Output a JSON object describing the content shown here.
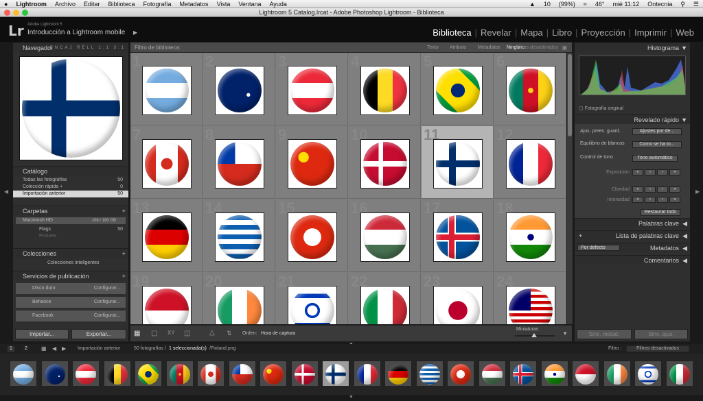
{
  "menubar": {
    "apple": "",
    "app": "Lightroom",
    "items": [
      "Archivo",
      "Editar",
      "Biblioteca",
      "Fotografía",
      "Metadatos",
      "Vista",
      "Ventana",
      "Ayuda"
    ],
    "battery": "(99%)",
    "badge": "10",
    "temp": "46°",
    "clock": "mié 11:12",
    "user": "Ontecnia"
  },
  "window_title": "Lightroom 5 Catalog.lrcat - Adobe Photoshop Lightroom - Biblioteca",
  "identity": {
    "product": "Adobe Lightroom 5",
    "subtitle": "Introducción a Lightroom mobile"
  },
  "modules": [
    "Biblioteca",
    "Revelar",
    "Mapa",
    "Libro",
    "Proyección",
    "Imprimir",
    "Web"
  ],
  "left": {
    "navigator": {
      "title": "Navegador",
      "modes": [
        "ENCAJ",
        "RELL",
        "1:1",
        "3:1"
      ]
    },
    "catalog": {
      "title": "Catálogo",
      "rows": [
        {
          "label": "Todas las fotografías",
          "count": "50"
        },
        {
          "label": "Colección rápida +",
          "count": "0"
        },
        {
          "label": "Importación anterior",
          "count": "50"
        }
      ]
    },
    "folders": {
      "title": "Carpetas",
      "drive": "Macintosh HD",
      "drive_size": "106 / 180 GB",
      "items": [
        {
          "label": "Flags",
          "count": "50"
        },
        {
          "label": "Pictures",
          "count": ""
        }
      ]
    },
    "collections": {
      "title": "Colecciones",
      "item": "Colecciones inteligentes"
    },
    "publish": {
      "title": "Servicios de publicación",
      "services": [
        {
          "label": "Disco duro",
          "action": "Configurar..."
        },
        {
          "label": "Behance",
          "action": "Configurar..."
        },
        {
          "label": "Facebook",
          "action": "Configurar..."
        }
      ]
    },
    "import_btn": "Importar...",
    "export_btn": "Exportar..."
  },
  "filterbar": {
    "label": "Filtro de biblioteca:",
    "tabs": [
      "Texto",
      "Atributo",
      "Metadatos",
      "Ninguno"
    ],
    "status": "Filtros desactivados"
  },
  "grid_numbers": [
    "1",
    "2",
    "3",
    "4",
    "5",
    "6",
    "7",
    "8",
    "9",
    "10",
    "11",
    "12",
    "13",
    "14",
    "15",
    "16",
    "17",
    "18",
    "19",
    "20",
    "21",
    "22",
    "23",
    "24"
  ],
  "toolbar": {
    "order_label": "Orden:",
    "order_value": "Hora de captura",
    "thumbs_label": "Miniaturas"
  },
  "right": {
    "histogram": {
      "title": "Histograma",
      "caption": "Fotografía original"
    },
    "quick_develop": {
      "title": "Revelado rápido",
      "preset_label": "Ajus. prees. guard.",
      "preset_value": "Ajustes por de...",
      "wb_label": "Equilibrio de blancos",
      "wb_value": "Como se ha to...",
      "tone_label": "Control de tono",
      "tone_value": "Tono automático",
      "exposure": "Exposición",
      "clarity": "Claridad",
      "vibrance": "Intensidad",
      "reset": "Restaurar todo"
    },
    "keywords": "Palabras clave",
    "keyword_list": "Lista de palabras clave",
    "metadata_preset": "Por defecto",
    "metadata": "Metadatos",
    "comments": "Comentarios",
    "sync_meta": "Sinc. metad.",
    "sync_settings": "Sinc. ajus."
  },
  "filmstrip_bar": {
    "pages": [
      "1",
      "2"
    ],
    "source": "Importación anterior",
    "info_count": "50 fotografías /",
    "info_selected": "1 seleccionada(s)",
    "info_file": "/Finland.png",
    "filter_label": "Filtro :",
    "filter_value": "Filtros desactivados"
  },
  "flags": [
    {
      "name": "argentina",
      "css": "linear-gradient(#74acdf 0 33%,#fff 33% 67%,#74acdf 67%)"
    },
    {
      "name": "australia",
      "css": "radial-gradient(circle at 70% 60%,#fff 0 4%,transparent 5%),linear-gradient(#012169,#012169)"
    },
    {
      "name": "austria",
      "css": "linear-gradient(#ed2939 0 33%,#fff 33% 67%,#ed2939 67%)"
    },
    {
      "name": "belgium",
      "css": "linear-gradient(90deg,#000 0 33%,#fdda24 33% 67%,#ef3340 67%)"
    },
    {
      "name": "brazil",
      "css": "radial-gradient(circle,#002776 0 22%,transparent 23%),linear-gradient(45deg,#009c3b 25%,#ffdf00 25% 75%,#009c3b 75%)"
    },
    {
      "name": "cameroon",
      "css": "radial-gradient(circle,#fcd116 0 8%,transparent 9%),linear-gradient(90deg,#007a5e 0 33%,#ce1126 33% 67%,#fcd116 67%)"
    },
    {
      "name": "canada",
      "css": "radial-gradient(circle,#d52b1e 0 18%,transparent 19%),linear-gradient(90deg,#d52b1e 0 25%,#fff 25% 75%,#d52b1e 75%)"
    },
    {
      "name": "chile",
      "css": "linear-gradient(90deg,#0039a6 0 40%,transparent 40%) top/100% 50% no-repeat,linear-gradient(#fff 0 50%,#d52b1e 50%)"
    },
    {
      "name": "china",
      "css": "radial-gradient(circle at 30% 35%,#ffde00 0 12%,transparent 13%),linear-gradient(#de2910,#de2910)"
    },
    {
      "name": "denmark",
      "css": "linear-gradient(90deg,transparent 0 35%,#fff 35% 45%,transparent 45%),linear-gradient(transparent 0 44%,#fff 44% 56%,transparent 56%),linear-gradient(#c60c30,#c60c30)"
    },
    {
      "name": "finland",
      "css": "linear-gradient(90deg,transparent 0 30%,#002f6c 30% 45%,transparent 45%),linear-gradient(transparent 0 42%,#002f6c 42% 58%,transparent 58%),linear-gradient(#fff,#fff)"
    },
    {
      "name": "france",
      "css": "linear-gradient(90deg,#002395 0 33%,#fff 33% 67%,#ed2939 67%)"
    },
    {
      "name": "germany",
      "css": "linear-gradient(#000 0 33%,#dd0000 33% 67%,#ffce00 67%)"
    },
    {
      "name": "greece",
      "css": "repeating-linear-gradient(#0d5eaf 0 11%,#fff 11% 22%)"
    },
    {
      "name": "hong-kong",
      "css": "radial-gradient(circle,#fff 0 28%,transparent 29%),linear-gradient(#de2910,#de2910)"
    },
    {
      "name": "hungary",
      "css": "linear-gradient(#ce2939 0 33%,#fff 33% 67%,#477050 67%)"
    },
    {
      "name": "iceland",
      "css": "linear-gradient(90deg,transparent 0 30%,#dc1e35 30% 42%,transparent 42%),linear-gradient(transparent 0 44%,#dc1e35 44% 56%,transparent 56%),linear-gradient(90deg,transparent 0 27%,#fff 27% 45%,transparent 45%),linear-gradient(transparent 0 40%,#fff 40% 60%,transparent 60%),linear-gradient(#02529c,#02529c)"
    },
    {
      "name": "india",
      "css": "radial-gradient(circle,#000080 0 10%,transparent 11%),linear-gradient(#ff9933 0 33%,#fff 33% 67%,#138808 67%)"
    },
    {
      "name": "indonesia",
      "css": "linear-gradient(#ce1126 0 50%,#fff 50%)"
    },
    {
      "name": "ireland",
      "css": "linear-gradient(90deg,#169b62 0 33%,#fff 33% 67%,#ff883e 67%)"
    },
    {
      "name": "israel",
      "css": "radial-gradient(circle,transparent 0 16%,#0038b8 17% 24%,transparent 25%),linear-gradient(#fff 0 12%,#0038b8 12% 22%,#fff 22% 78%,#0038b8 78% 88%,#fff 88%)"
    },
    {
      "name": "italy",
      "css": "linear-gradient(90deg,#009246 0 33%,#fff 33% 67%,#ce2b37 67%)"
    },
    {
      "name": "japan",
      "css": "radial-gradient(circle,#bc002d 0 30%,#fff 31%)"
    },
    {
      "name": "malaysia",
      "css": "linear-gradient(90deg,#010066 0 50%,transparent 50%) top/100% 50% no-repeat,repeating-linear-gradient(#cc0001 0 7%,#fff 7% 14%)"
    }
  ],
  "filmstrip_flags": [
    "argentina",
    "australia",
    "austria",
    "belgium",
    "brazil",
    "cameroon",
    "canada",
    "chile",
    "china",
    "denmark",
    "finland",
    "france",
    "germany",
    "greece",
    "hong-kong",
    "hungary",
    "iceland",
    "india",
    "indonesia",
    "ireland",
    "israel",
    "italy"
  ]
}
